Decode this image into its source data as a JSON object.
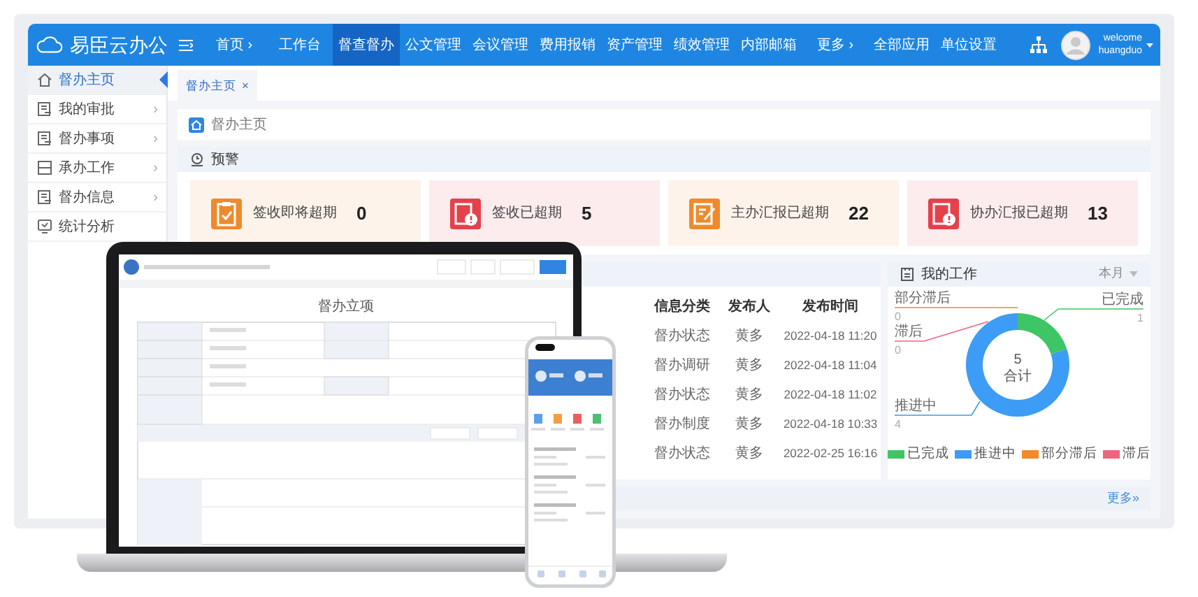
{
  "header": {
    "brand": "易臣云办公",
    "nav": [
      {
        "label": "首页",
        "arrow": "›",
        "selected": false
      },
      {
        "label": "工作台",
        "selected": false
      },
      {
        "label": "督查督办",
        "selected": true
      },
      {
        "label": "公文管理",
        "selected": false
      },
      {
        "label": "会议管理",
        "selected": false
      },
      {
        "label": "费用报销",
        "selected": false
      },
      {
        "label": "资产管理",
        "selected": false
      },
      {
        "label": "绩效管理",
        "selected": false
      },
      {
        "label": "内部邮箱",
        "selected": false
      },
      {
        "label": "更多",
        "arrow": "›",
        "selected": false
      },
      {
        "label": "全部应用",
        "selected": false
      },
      {
        "label": "单位设置",
        "selected": false
      }
    ],
    "user": {
      "greeting": "welcome",
      "name": "huangduo"
    }
  },
  "sidebar": {
    "items": [
      {
        "label": "督办主页",
        "selected": true
      },
      {
        "label": "我的审批",
        "arrow": "›",
        "selected": false
      },
      {
        "label": "督办事项",
        "arrow": "›",
        "selected": false
      },
      {
        "label": "承办工作",
        "arrow": "›",
        "selected": false
      },
      {
        "label": "督办信息",
        "arrow": "›",
        "selected": false
      },
      {
        "label": "统计分析",
        "selected": false
      }
    ]
  },
  "tabs": [
    {
      "label": "督办主页",
      "close": "×",
      "selected": true
    }
  ],
  "breadcrumb": {
    "label": "督办主页"
  },
  "warning": {
    "title": "预警",
    "cards": [
      {
        "kind": "clipboard",
        "label": "签收即将超期",
        "value": "0",
        "color": "#ef8a2c"
      },
      {
        "kind": "alert",
        "label": "签收已超期",
        "value": "5",
        "color": "#e5414b"
      },
      {
        "kind": "edit",
        "label": "主办汇报已超期",
        "value": "22",
        "color": "#ef8a2c"
      },
      {
        "kind": "alert",
        "label": "协办汇报已超期",
        "value": "13",
        "color": "#e5414b"
      }
    ]
  },
  "info_table": {
    "columns": [
      "信息分类",
      "发布人",
      "发布时间"
    ],
    "rows": [
      [
        "督办状态",
        "黄多",
        "2022-04-18 11:20"
      ],
      [
        "督办调研",
        "黄多",
        "2022-04-18 11:04"
      ],
      [
        "督办状态",
        "黄多",
        "2022-04-18 11:02"
      ],
      [
        "督办制度",
        "黄多",
        "2022-04-18 10:33"
      ],
      [
        "督办状态",
        "黄多",
        "2022-02-25 16:16"
      ]
    ]
  },
  "my_work": {
    "title": "我的工作",
    "period": "本月",
    "total": "5",
    "total_label": "合计",
    "chart_data": {
      "type": "donut",
      "categories": [
        "已完成",
        "推进中",
        "部分滞后",
        "滞后"
      ],
      "series": [
        {
          "values": [
            1,
            4,
            0,
            0
          ]
        }
      ],
      "data_labels": true,
      "value_labels": [
        "1",
        "4",
        "0",
        "0"
      ]
    },
    "legend": [
      {
        "label": "已完成",
        "color": "#3ec565"
      },
      {
        "label": "推进中",
        "color": "#3d9cf5"
      },
      {
        "label": "部分滞后",
        "color": "#f08a2a"
      },
      {
        "label": "滞后",
        "color": "#f0637f"
      }
    ]
  },
  "footer": {
    "more_link": "更多»"
  },
  "laptop": {
    "form_title": "督办立项"
  }
}
